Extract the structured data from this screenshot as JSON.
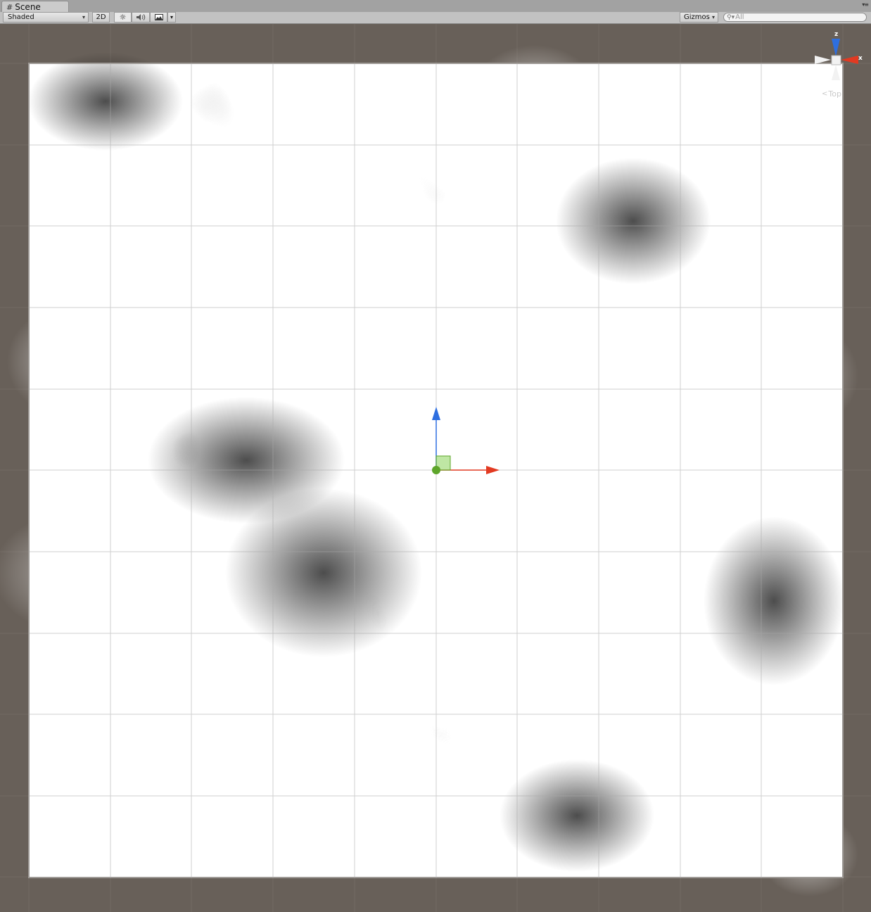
{
  "window": {
    "tab_title": "Scene"
  },
  "toolbar": {
    "draw_mode": "Shaded",
    "mode_2d_label": "2D",
    "gizmos_label": "Gizmos",
    "search_placeholder": "All"
  },
  "icons": {
    "scene_tab": "grid-icon",
    "lighting": "sun-icon",
    "audio": "speaker-icon",
    "effects": "image-icon",
    "search": "search-icon"
  },
  "orientation_gizmo": {
    "axis_x": "x",
    "axis_z": "z",
    "view_label": "Top"
  },
  "colors": {
    "background": "#686059",
    "x_axis": "#e23a22",
    "z_axis": "#2e6fe0",
    "y_axis": "#5da52a"
  }
}
